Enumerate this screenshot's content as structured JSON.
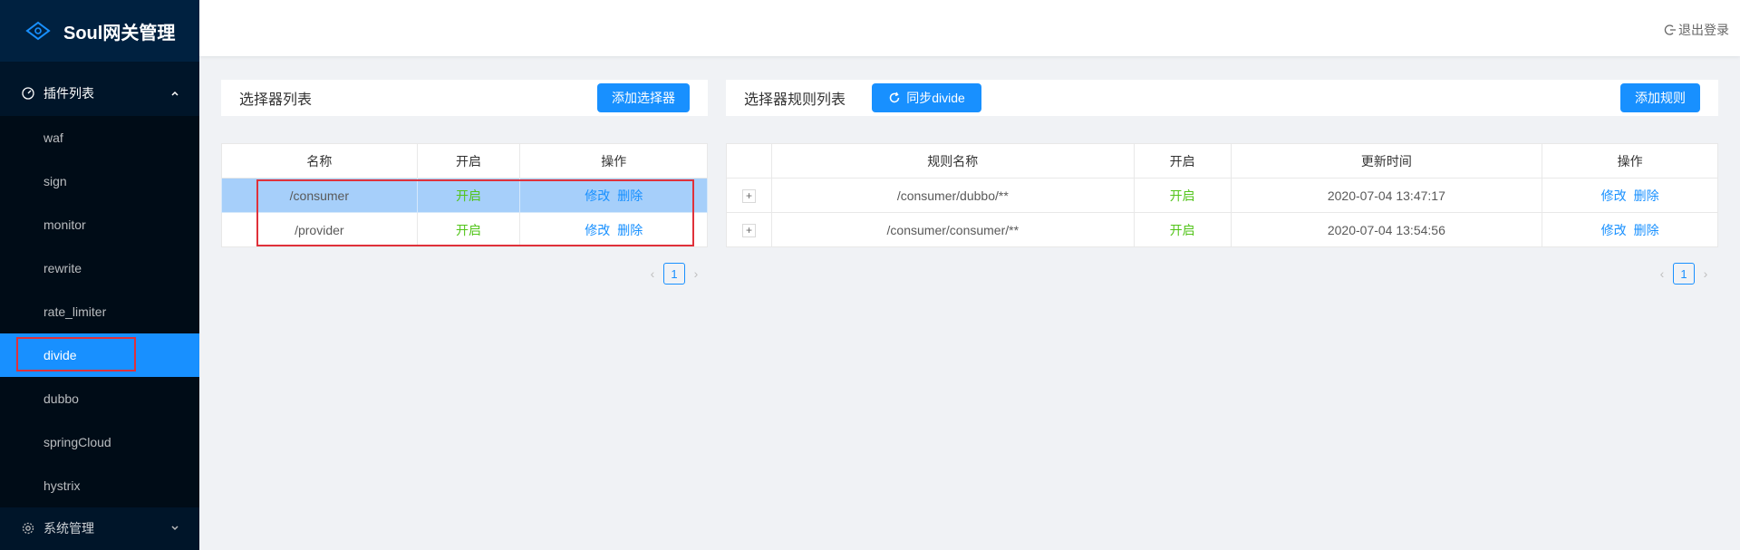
{
  "app": {
    "title": "Soul网关管理"
  },
  "sidebar": {
    "plugin_group": "插件列表",
    "items": [
      {
        "label": "waf"
      },
      {
        "label": "sign"
      },
      {
        "label": "monitor"
      },
      {
        "label": "rewrite"
      },
      {
        "label": "rate_limiter"
      },
      {
        "label": "divide"
      },
      {
        "label": "dubbo"
      },
      {
        "label": "springCloud"
      },
      {
        "label": "hystrix"
      }
    ],
    "system_group": "系统管理",
    "active_item": "divide"
  },
  "header": {
    "logout_label": "退出登录"
  },
  "selector_panel": {
    "title": "选择器列表",
    "add_button": "添加选择器",
    "columns": [
      "名称",
      "开启",
      "操作"
    ],
    "rows": [
      {
        "name": "/consumer",
        "enabled": "开启",
        "edit": "修改",
        "delete": "删除"
      },
      {
        "name": "/provider",
        "enabled": "开启",
        "edit": "修改",
        "delete": "删除"
      }
    ],
    "page": "1"
  },
  "rule_panel": {
    "title": "选择器规则列表",
    "sync_button": "同步divide",
    "add_button": "添加规则",
    "columns": [
      "",
      "规则名称",
      "开启",
      "更新时间",
      "操作"
    ],
    "rows": [
      {
        "expand": "+",
        "name": "/consumer/dubbo/**",
        "enabled": "开启",
        "updated": "2020-07-04 13:47:17",
        "edit": "修改",
        "delete": "删除"
      },
      {
        "expand": "+",
        "name": "/consumer/consumer/**",
        "enabled": "开启",
        "updated": "2020-07-04 13:54:56",
        "edit": "修改",
        "delete": "删除"
      }
    ],
    "page": "1"
  },
  "colors": {
    "primary": "#1890ff",
    "sidebar_bg": "#001529",
    "enabled_green": "#52c41a",
    "highlight_red": "#e0313a"
  }
}
